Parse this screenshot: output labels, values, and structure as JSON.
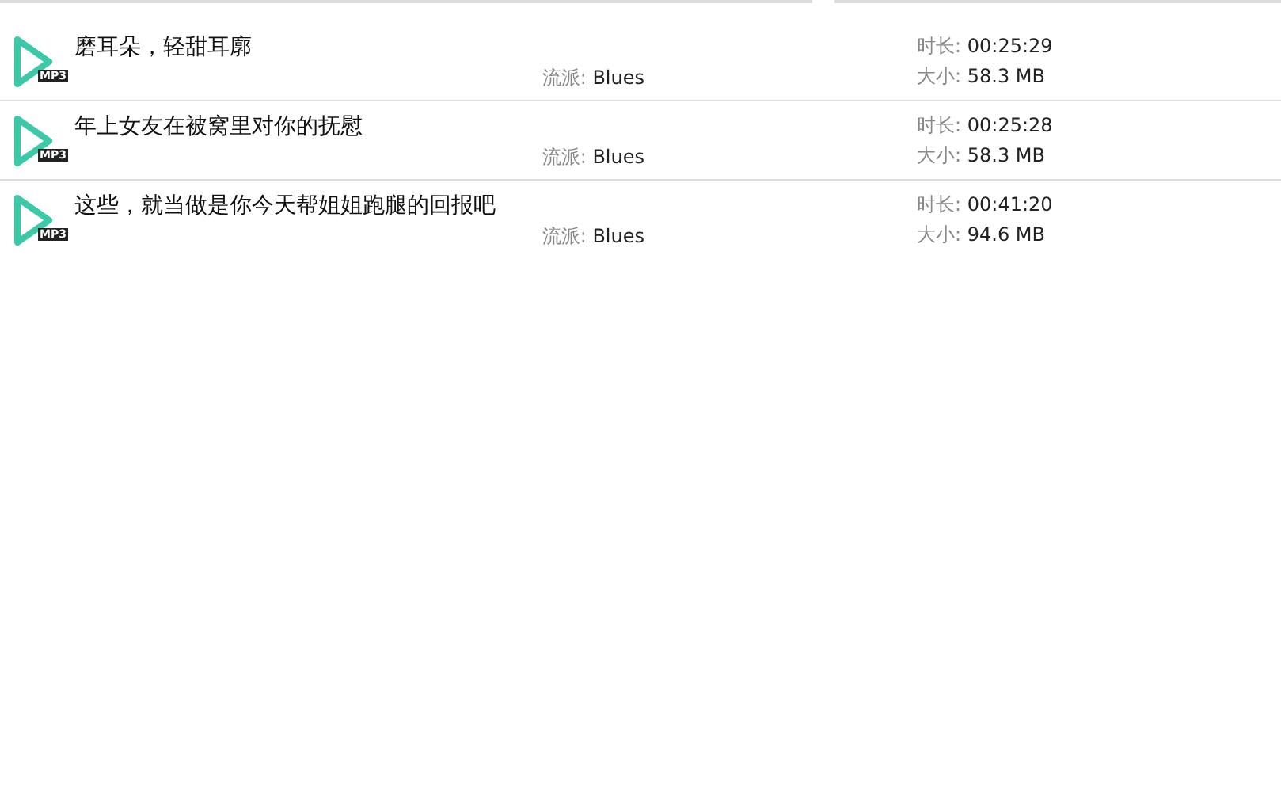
{
  "tracks": [
    {
      "badge": "MP3",
      "title": "磨耳朵，轻甜耳廓",
      "genre_label": "流派:",
      "genre": "Blues",
      "duration_label": "时长:",
      "duration": "00:25:29",
      "size_label": "大小:",
      "size": "58.3 MB"
    },
    {
      "badge": "MP3",
      "title": "年上女友在被窝里对你的抚慰",
      "genre_label": "流派:",
      "genre": "Blues",
      "duration_label": "时长:",
      "duration": "00:25:28",
      "size_label": "大小:",
      "size": "58.3 MB"
    },
    {
      "badge": "MP3",
      "title": "这些，就当做是你今天帮姐姐跑腿的回报吧",
      "genre_label": "流派:",
      "genre": "Blues",
      "duration_label": "时长:",
      "duration": "00:41:20",
      "size_label": "大小:",
      "size": "94.6 MB"
    }
  ]
}
